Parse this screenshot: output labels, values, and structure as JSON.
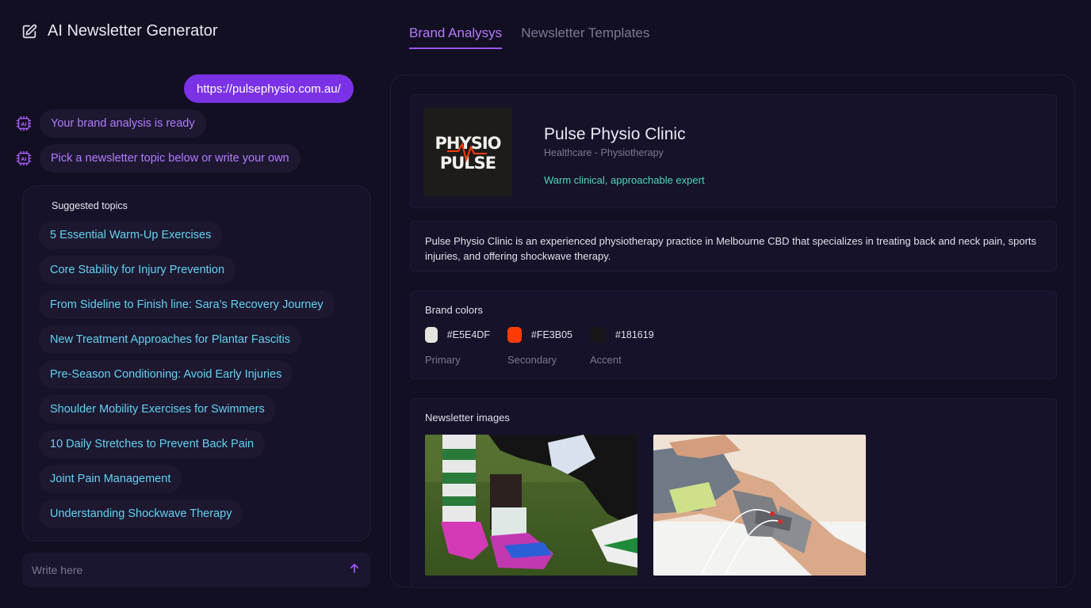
{
  "app": {
    "title": "AI Newsletter Generator"
  },
  "chat": {
    "user_url": "https://pulsephysio.com.au/",
    "bot_messages": [
      "Your brand analysis is ready",
      "Pick a newsletter topic below or write your own"
    ]
  },
  "topics": {
    "title": "Suggested topics",
    "items": [
      "5 Essential Warm-Up Exercises",
      "Core Stability for Injury Prevention",
      "From Sideline to Finish line: Sara’s Recovery Journey",
      "New Treatment Approaches for Plantar Fascitis",
      "Pre-Season Conditioning: Avoid Early Injuries",
      "Shoulder Mobility Exercises for Swimmers",
      "10 Daily Stretches to Prevent Back Pain",
      "Joint Pain Management",
      "Understanding Shockwave Therapy"
    ]
  },
  "input": {
    "placeholder": "Write here"
  },
  "tabs": [
    {
      "label": "Brand Analysys",
      "active": true
    },
    {
      "label": "Newsletter Templates",
      "active": false
    }
  ],
  "brand": {
    "logo_lines": [
      "PHYSIO",
      "PULSE"
    ],
    "name": "Pulse Physio Clinic",
    "category": "Healthcare - Physiotherapy",
    "tone": "Warm clinical, approachable expert",
    "description": "Pulse Physio Clinic is an experienced physiotherapy practice in Melbourne CBD that specializes in treating back and neck pain, sports injuries, and offering shockwave therapy."
  },
  "colors": {
    "title": "Brand colors",
    "items": [
      {
        "hex": "#E5E4DF",
        "role": "Primary"
      },
      {
        "hex": "#FE3B05",
        "role": "Secondary"
      },
      {
        "hex": "#181619",
        "role": "Accent"
      }
    ]
  },
  "images": {
    "title": "Newsletter images"
  },
  "theme": {
    "accent": "#7b32e6",
    "topic_text": "#62d2f0",
    "bot_text": "#b27bff",
    "tone_text": "#4fd7b3"
  }
}
